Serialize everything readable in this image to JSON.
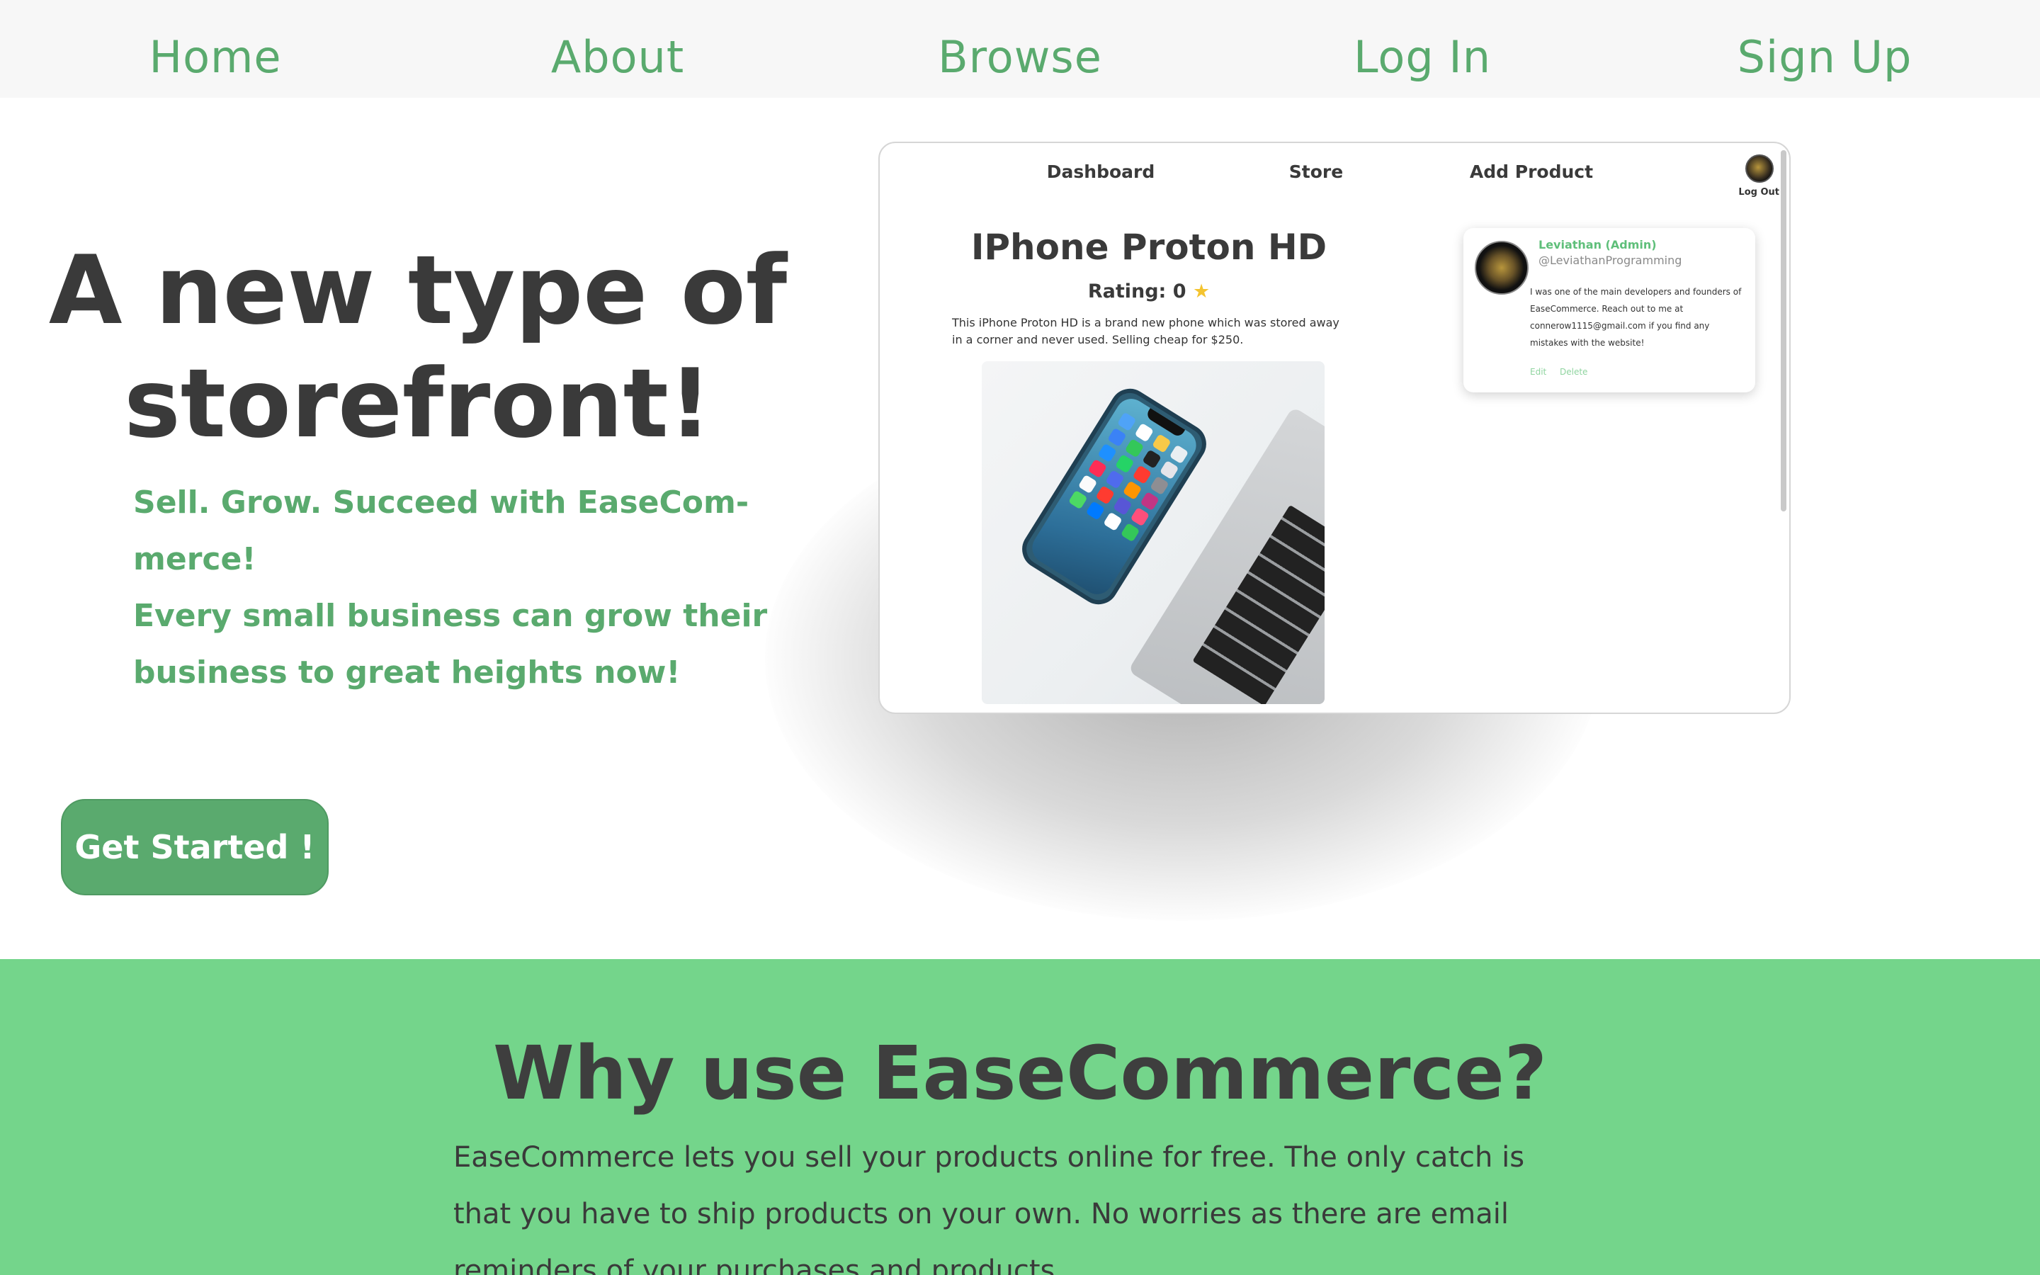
{
  "nav": {
    "items": [
      {
        "label": "Home",
        "name": "nav-home"
      },
      {
        "label": "About",
        "name": "nav-about"
      },
      {
        "label": "Browse",
        "name": "nav-browse"
      },
      {
        "label": "Log In",
        "name": "nav-login"
      },
      {
        "label": "Sign Up",
        "name": "nav-signup"
      }
    ]
  },
  "hero": {
    "title_line1": "A new type of",
    "title_line2": "storefront!",
    "sub_line1": "Sell. Grow. Succeed with EaseCom-",
    "sub_line2": "merce!",
    "sub_line3": "Every small business can grow their",
    "sub_line4": "business to great heights now!",
    "cta_label": "Get Started !"
  },
  "preview": {
    "nav": {
      "dashboard": "Dashboard",
      "store": "Store",
      "add_product": "Add Product",
      "logout": "Log Out"
    },
    "product": {
      "title": "IPhone Proton HD",
      "rating_label": "Rating: 0",
      "rating_icon": "star-icon",
      "description": "This iPhone Proton HD is a brand new phone which was stored away in a corner and never used. Selling cheap for $250."
    },
    "card": {
      "name": "Leviathan (Admin)",
      "handle": "@LeviathanProgramming",
      "bio": "I was one of the main developers and founders of EaseCommerce. Reach out to me at connerow1115@gmail.com if you find any mistakes with the website!",
      "edit": "Edit",
      "delete": "Delete"
    }
  },
  "why": {
    "title": "Why use EaseCommerce?",
    "text": "EaseCommerce lets you sell your products online for free. The only catch is that you have to ship products on your own. No worries as there are email reminders of your purchases and products."
  },
  "colors": {
    "accent_green": "#5aaa6e",
    "section_green": "#74d58b",
    "text_dark": "#3a3a3a",
    "nav_bg": "#f7f7f7"
  }
}
